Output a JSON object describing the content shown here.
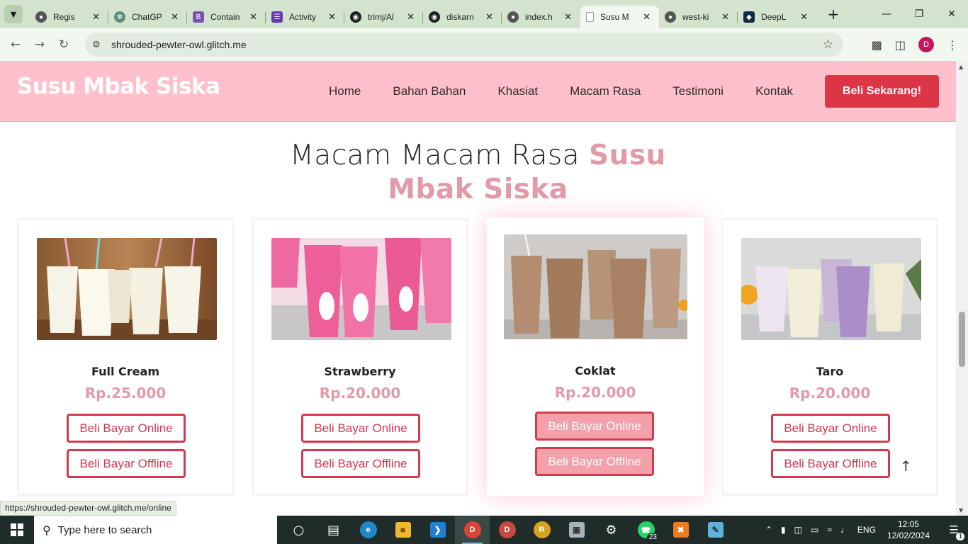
{
  "browser": {
    "tabs": [
      {
        "title": "Regis",
        "icon": "globe-icon",
        "color": "#555555",
        "active": false
      },
      {
        "title": "ChatGP",
        "icon": "chatgpt-icon",
        "color": "#5a8f7b",
        "active": false
      },
      {
        "title": "Contain",
        "icon": "bootstrap-icon",
        "color": "#7952b3",
        "active": false
      },
      {
        "title": "Activity",
        "icon": "form-icon",
        "color": "#673ab7",
        "active": false
      },
      {
        "title": "trimj/Al",
        "icon": "github-icon",
        "color": "#1f1f1f",
        "active": false
      },
      {
        "title": "diskarn",
        "icon": "github-icon",
        "color": "#1f1f1f",
        "active": false
      },
      {
        "title": "index.h",
        "icon": "globe-icon",
        "color": "#555555",
        "active": false
      },
      {
        "title": "Susu M",
        "icon": "page-icon",
        "color": "#9aa0a6",
        "active": true
      },
      {
        "title": "west-ki",
        "icon": "globe-icon",
        "color": "#555555",
        "active": false
      },
      {
        "title": "DeepL",
        "icon": "deepl-icon",
        "color": "#0f2b46",
        "active": false
      }
    ],
    "url": "shrouded-pewter-owl.glitch.me",
    "profile_initial": "D",
    "status_url": "https://shrouded-pewter-owl.glitch.me/online"
  },
  "site": {
    "brand": "Susu Mbak Siska",
    "nav": [
      "Home",
      "Bahan Bahan",
      "Khasiat",
      "Macam Rasa",
      "Testimoni",
      "Kontak"
    ],
    "cta": "Beli Sekarang!",
    "section_title_plain": "Macam Macam Rasa",
    "section_title_accent_1": "Susu",
    "section_title_accent_2": "Mbak Siska",
    "products": [
      {
        "name": "Full Cream",
        "price": "Rp.25.000",
        "online": "Beli Bayar Online",
        "offline": "Beli Bayar Offline"
      },
      {
        "name": "Strawberry",
        "price": "Rp.20.000",
        "online": "Beli Bayar Online",
        "offline": "Beli Bayar Offline"
      },
      {
        "name": "Coklat",
        "price": "Rp.20.000",
        "online": "Beli Bayar Online",
        "offline": "Beli Bayar Offline"
      },
      {
        "name": "Taro",
        "price": "Rp.20.000",
        "online": "Beli Bayar Online",
        "offline": "Beli Bayar Offline"
      }
    ],
    "colors": {
      "header_bg": "#ffc0cb",
      "accent": "#e29aa8",
      "button": "#dc3545"
    }
  },
  "taskbar": {
    "search_placeholder": "Type here to search",
    "whatsapp_badge": "23",
    "language": "ENG",
    "time": "12:05",
    "date": "12/02/2024",
    "notification_count": "1"
  }
}
